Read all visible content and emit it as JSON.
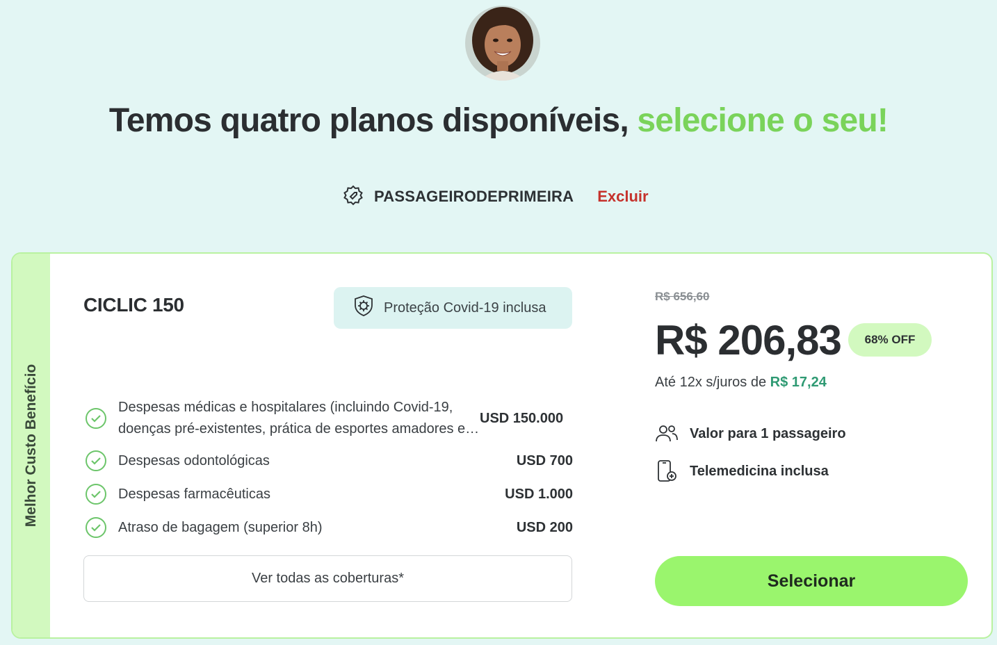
{
  "header": {
    "title_prefix": "Temos quatro planos disponíveis, ",
    "title_accent": "selecione o seu!"
  },
  "coupon": {
    "code": "PASSAGEIRODEPRIMEIRA",
    "remove_label": "Excluir",
    "icon": "coupon-tag-icon"
  },
  "plan": {
    "ribbon": "Melhor Custo Benefício",
    "name": "CICLIC 150",
    "badge": "Proteção Covid-19 inclusa",
    "coverages": [
      {
        "label": "Despesas médicas e hospitalares (incluindo Covid-19, doenças pré-existentes, prática de esportes amadores e gestantes)",
        "value": "USD 150.000"
      },
      {
        "label": "Despesas odontológicas",
        "value": "USD 700"
      },
      {
        "label": "Despesas farmacêuticas",
        "value": "USD 1.000"
      },
      {
        "label": "Atraso de bagagem (superior 8h)",
        "value": "USD 200"
      }
    ],
    "see_all_label": "Ver todas as coberturas*",
    "old_price": "R$ 656,60",
    "price": "R$ 206,83",
    "discount": "68% OFF",
    "installments_prefix": "Até 12x s/juros de ",
    "installments_value": "R$ 17,24",
    "passengers_label": "Valor para 1 passageiro",
    "telemedicine_label": "Telemedicina inclusa",
    "select_label": "Selecionar"
  },
  "colors": {
    "background": "#e3f6f4",
    "accent_green": "#7ad35a",
    "button_green": "#9af56d",
    "danger_red": "#c5322c",
    "installment_teal": "#2f9a73"
  }
}
